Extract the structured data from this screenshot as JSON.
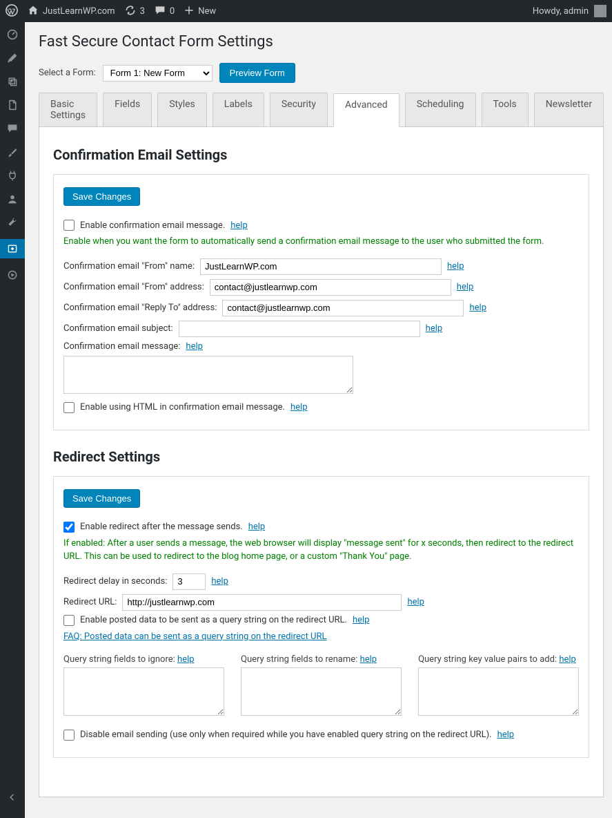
{
  "adminbar": {
    "site_name": "JustLearnWP.com",
    "updates_count": "3",
    "comments_count": "0",
    "new_label": "New",
    "howdy": "Howdy, admin"
  },
  "page": {
    "title": "Fast Secure Contact Form Settings",
    "select_form_label": "Select a Form:",
    "form_options": [
      "Form 1: New Form"
    ],
    "preview_btn": "Preview Form"
  },
  "tabs": [
    "Basic Settings",
    "Fields",
    "Styles",
    "Labels",
    "Security",
    "Advanced",
    "Scheduling",
    "Tools",
    "Newsletter"
  ],
  "active_tab": "Advanced",
  "help_label": "help",
  "save_label": "Save Changes",
  "confirmation": {
    "heading": "Confirmation Email Settings",
    "enable_label": "Enable confirmation email message.",
    "enable_desc": "Enable when you want the form to automatically send a confirmation email message to the user who submitted the form.",
    "from_name_label": "Confirmation email \"From\" name:",
    "from_name_value": "JustLearnWP.com",
    "from_addr_label": "Confirmation email \"From\" address:",
    "from_addr_value": "contact@justlearnwp.com",
    "reply_to_label": "Confirmation email \"Reply To\" address:",
    "reply_to_value": "contact@justlearnwp.com",
    "subject_label": "Confirmation email subject:",
    "subject_value": "",
    "message_label": "Confirmation email message:",
    "message_value": "",
    "html_label": "Enable using HTML in confirmation email message."
  },
  "redirect": {
    "heading": "Redirect Settings",
    "enable_label": "Enable redirect after the message sends.",
    "enable_checked": true,
    "enable_desc": "If enabled: After a user sends a message, the web browser will display \"message sent\" for x seconds, then redirect to the redirect URL. This can be used to redirect to the blog home page, or a custom \"Thank You\" page.",
    "delay_label": "Redirect delay in seconds:",
    "delay_value": "3",
    "url_label": "Redirect URL:",
    "url_value": "http://justlearnwp.com",
    "posted_data_label": "Enable posted data to be sent as a query string on the redirect URL.",
    "faq_label": "FAQ: Posted data can be sent as a query string on the redirect URL",
    "q_ignore_label": "Query string fields to ignore:",
    "q_rename_label": "Query string fields to rename:",
    "q_add_label": "Query string key value pairs to add:",
    "disable_email_label": "Disable email sending (use only when required while you have enabled query string on the redirect URL)."
  }
}
